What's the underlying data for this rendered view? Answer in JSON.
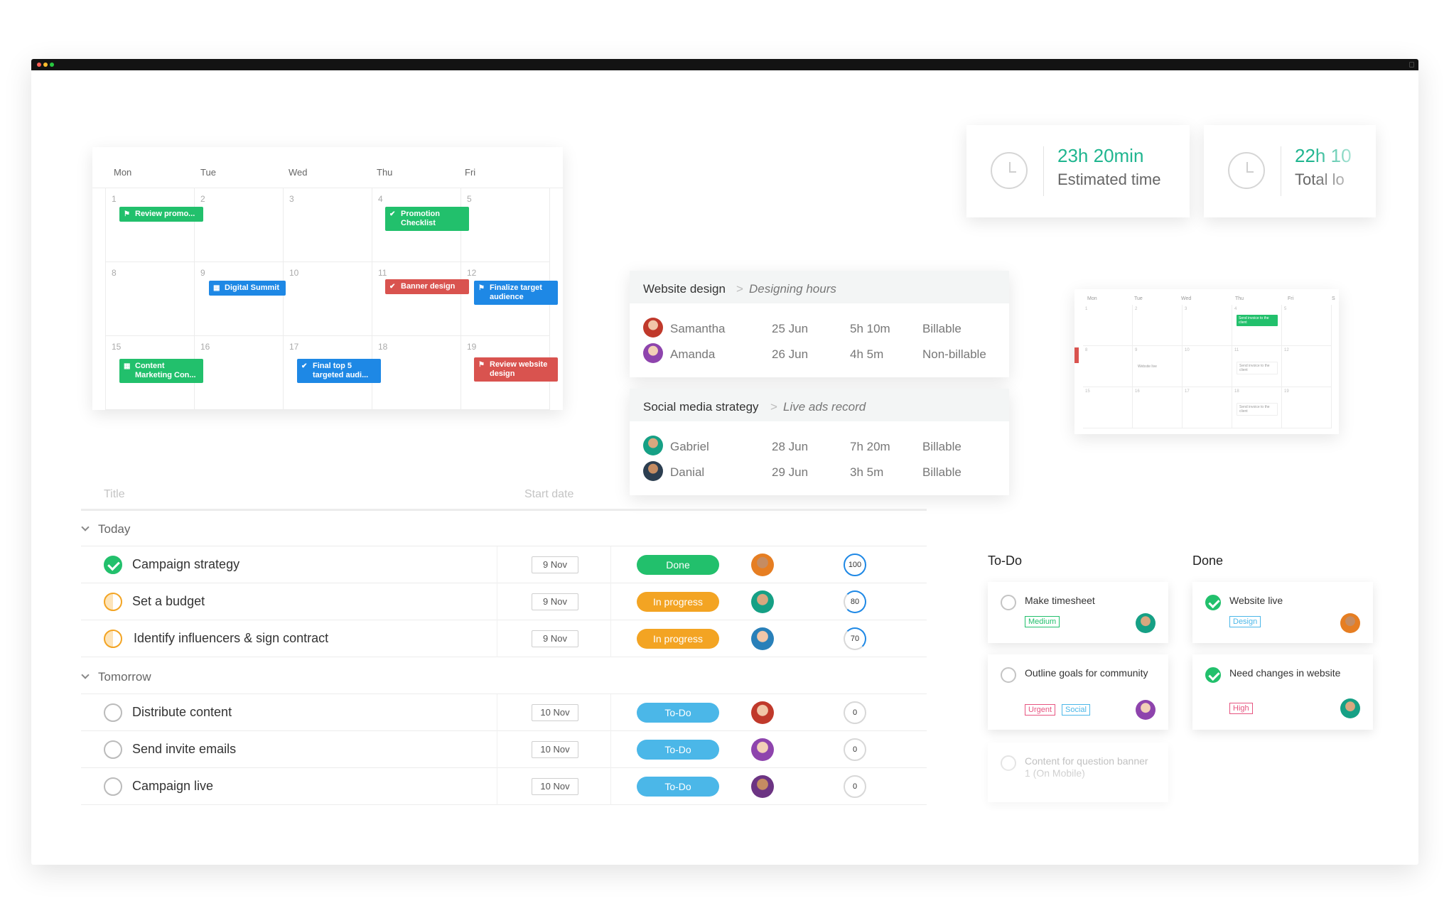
{
  "calendar": {
    "days": [
      "Mon",
      "Tue",
      "Wed",
      "Thu",
      "Fri"
    ],
    "weeks": [
      [
        "1",
        "2",
        "3",
        "4",
        "5"
      ],
      [
        "8",
        "9",
        "10",
        "11",
        "12"
      ],
      [
        "15",
        "16",
        "17",
        "18",
        "19"
      ]
    ],
    "events": {
      "review_promo": "Review promo...",
      "promotion_checklist_1": "Promotion",
      "promotion_checklist_2": "Checklist",
      "digital_summit": "Digital Summit",
      "banner_design": "Banner design",
      "finalize_1": "Finalize target",
      "finalize_2": "audience",
      "content_1": "Content",
      "content_2": "Marketing Con...",
      "final_top_1": "Final top 5",
      "final_top_2": "targeted audi...",
      "review_website_1": "Review website",
      "review_website_2": "design"
    }
  },
  "time_cards": {
    "estimated": {
      "value": "23h 20min",
      "label": "Estimated time"
    },
    "logged": {
      "value": "22h 10",
      "label": "Total lo"
    }
  },
  "timesheets": [
    {
      "project": "Website design",
      "subtitle": "Designing hours",
      "rows": [
        {
          "name": "Samantha",
          "date": "25 Jun",
          "duration": "5h 10m",
          "billing": "Billable"
        },
        {
          "name": "Amanda",
          "date": "26 Jun",
          "duration": "4h 5m",
          "billing": "Non-billable"
        }
      ]
    },
    {
      "project": "Social media strategy",
      "subtitle": "Live ads record",
      "rows": [
        {
          "name": "Gabriel",
          "date": "28 Jun",
          "duration": "7h 20m",
          "billing": "Billable"
        },
        {
          "name": "Danial",
          "date": "29 Jun",
          "duration": "3h 5m",
          "billing": "Billable"
        }
      ]
    }
  ],
  "task_list": {
    "columns": {
      "title": "Title",
      "start_date": "Start date"
    },
    "groups": [
      {
        "label": "Today",
        "tasks": [
          {
            "title": "Campaign strategy",
            "date": "9 Nov",
            "status": "Done",
            "progress": "100"
          },
          {
            "title": "Set a budget",
            "date": "9 Nov",
            "status": "In progress",
            "progress": "80"
          },
          {
            "title": "Identify influencers & sign contract",
            "date": "9 Nov",
            "status": "In progress",
            "progress": "70"
          }
        ]
      },
      {
        "label": "Tomorrow",
        "tasks": [
          {
            "title": "Distribute content",
            "date": "10 Nov",
            "status": "To-Do",
            "progress": "0"
          },
          {
            "title": "Send invite emails",
            "date": "10 Nov",
            "status": "To-Do",
            "progress": "0"
          },
          {
            "title": "Campaign live",
            "date": "10 Nov",
            "status": "To-Do",
            "progress": "0"
          }
        ]
      }
    ]
  },
  "kanban": {
    "todo": {
      "title": "To-Do",
      "cards": [
        {
          "text": "Make timesheet",
          "tags": [
            "Medium"
          ]
        },
        {
          "text": "Outline goals for community",
          "tags": [
            "Urgent",
            "Social"
          ]
        },
        {
          "text": "Content for question banner 1 (On Mobile)",
          "tags": []
        }
      ]
    },
    "done": {
      "title": "Done",
      "cards": [
        {
          "text": "Website live",
          "tags": [
            "Design"
          ]
        },
        {
          "text": "Need changes in website",
          "tags": [
            "High"
          ]
        }
      ]
    }
  },
  "mini_calendar": {
    "days": [
      "Mon",
      "Tue",
      "Wed",
      "Thu",
      "Fri",
      "S"
    ],
    "weeks": [
      [
        "1",
        "2",
        "3",
        "4",
        "5"
      ],
      [
        "8",
        "9",
        "10",
        "11",
        "12"
      ],
      [
        "15",
        "16",
        "17",
        "18",
        "19"
      ]
    ],
    "events": {
      "send_invoice": "Send invoice to the client",
      "website_live": "Website live",
      "send_invoice_2": "Send invoice to the client",
      "send_invoice_3": "Send invoice to the client"
    }
  },
  "colors": {
    "green": "#22c06c",
    "orange": "#f3a423",
    "blue": "#4bb7e8",
    "event_blue": "#1e88e5",
    "event_red": "#d9534f",
    "teal": "#1fb58f"
  }
}
